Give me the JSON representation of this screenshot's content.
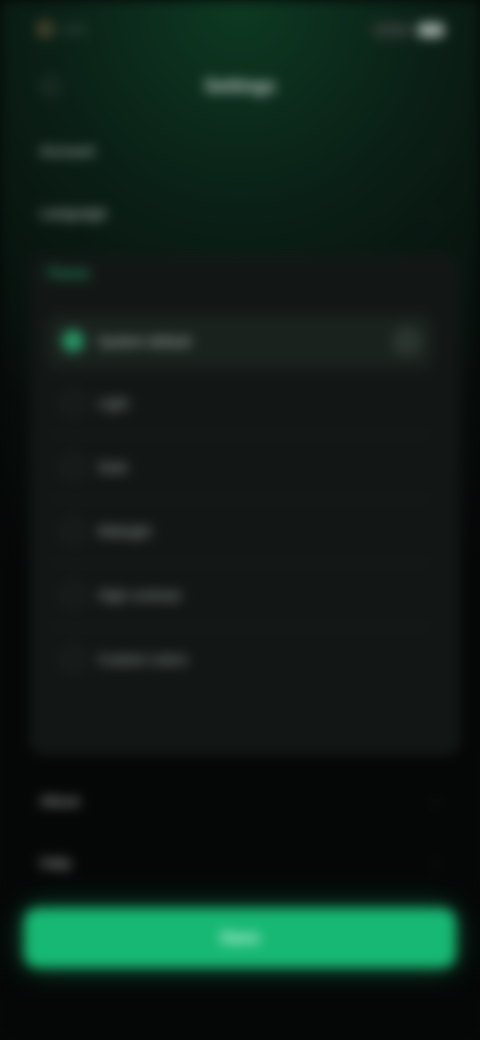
{
  "status_bar": {
    "time": "9:41"
  },
  "nav": {
    "title": "Settings"
  },
  "rows_top": [
    {
      "label": "Account"
    },
    {
      "label": "Language"
    }
  ],
  "group": {
    "header": "Theme",
    "options": [
      {
        "label": "System default",
        "selected": true
      },
      {
        "label": "Light"
      },
      {
        "label": "Dark"
      },
      {
        "label": "Midnight"
      },
      {
        "label": "High contrast"
      },
      {
        "label": "Custom colors"
      }
    ]
  },
  "rows_bottom": [
    {
      "label": "About"
    },
    {
      "label": "Help"
    }
  ],
  "primary_button": {
    "label": "Save"
  },
  "colors": {
    "accent": "#2ecb86",
    "button": "#17b873",
    "background": "#070c0a"
  }
}
